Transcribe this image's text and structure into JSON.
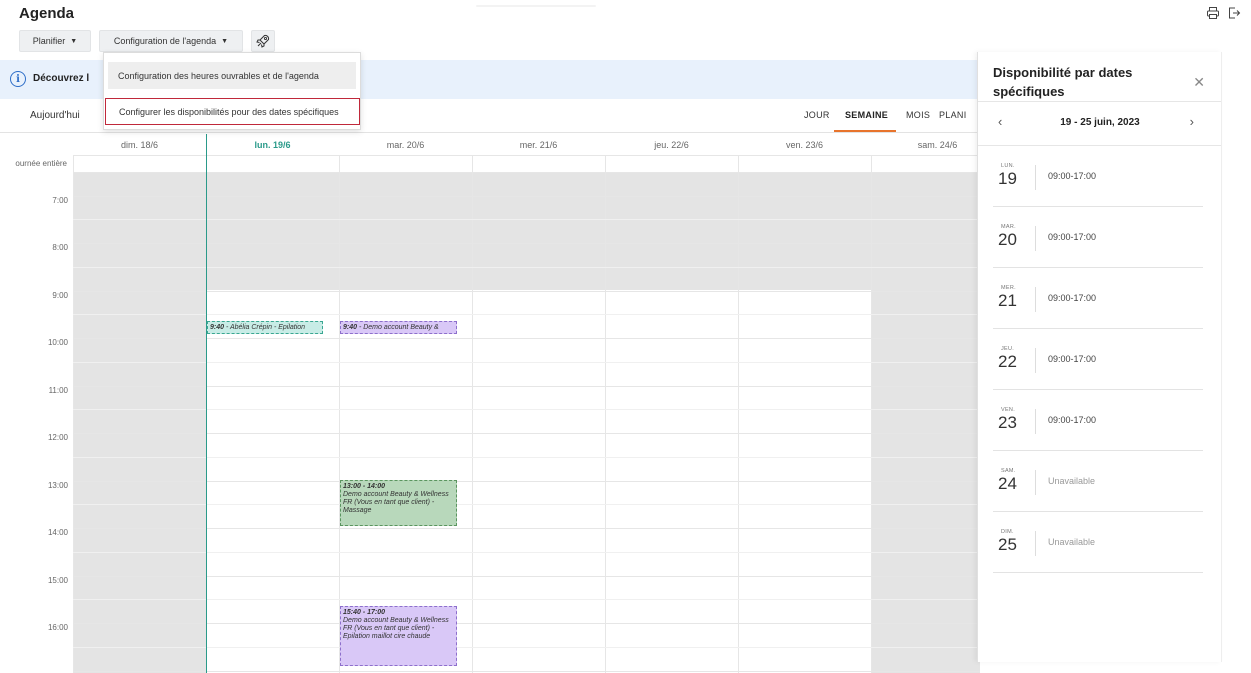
{
  "header": {
    "title": "Agenda",
    "planifier_label": "Planifier",
    "config_label": "Configuration de l'agenda"
  },
  "dropdown": {
    "items": [
      "Configuration des heures ouvrables et de l'agenda",
      "Configurer les disponibilités pour des dates spécifiques"
    ]
  },
  "banner": {
    "text": "Découvrez l"
  },
  "toolbar": {
    "today_label": "Aujourd'hui",
    "views": [
      "JOUR",
      "SEMAINE",
      "MOIS",
      "PLANI"
    ],
    "active_view": "SEMAINE"
  },
  "calendar": {
    "days": [
      "dim. 18/6",
      "lun. 19/6",
      "mar. 20/6",
      "mer. 21/6",
      "jeu. 22/6",
      "ven. 23/6",
      "sam. 24/6"
    ],
    "today_index": 1,
    "allday_label": "ournée entière",
    "hours": [
      "7:00",
      "8:00",
      "9:00",
      "10:00",
      "11:00",
      "12:00",
      "13:00",
      "14:00",
      "15:00",
      "16:00"
    ],
    "events": [
      {
        "day": 1,
        "time": "9:40",
        "title": " - Abélia Crépin - Epilation",
        "color": "teal"
      },
      {
        "day": 2,
        "time": "9:40",
        "title": " - Demo account Beauty &",
        "color": "purple"
      },
      {
        "day": 2,
        "time": "13:00 - 14:00",
        "title": "Demo account Beauty & Wellness FR (Vous en tant que client) - Massage",
        "color": "green"
      },
      {
        "day": 2,
        "time": "15:40 - 17:00",
        "title": "Demo account Beauty & Wellness FR (Vous en tant que client) - Epilation maillot cire chaude",
        "color": "purple"
      }
    ]
  },
  "panel": {
    "title": "Disponibilité par dates spécifiques",
    "range": "19 - 25 juin, 2023",
    "days": [
      {
        "abbr": "LUN.",
        "num": "19",
        "hours": "09:00-17:00"
      },
      {
        "abbr": "MAR.",
        "num": "20",
        "hours": "09:00-17:00"
      },
      {
        "abbr": "MER.",
        "num": "21",
        "hours": "09:00-17:00"
      },
      {
        "abbr": "JEU.",
        "num": "22",
        "hours": "09:00-17:00"
      },
      {
        "abbr": "VEN.",
        "num": "23",
        "hours": "09:00-17:00"
      },
      {
        "abbr": "SAM.",
        "num": "24",
        "hours": "Unavailable"
      },
      {
        "abbr": "DIM.",
        "num": "25",
        "hours": "Unavailable"
      }
    ]
  },
  "colors": {
    "accent": "#e8742c",
    "today": "#2a9a8a",
    "highlight_border": "#c0283a",
    "banner_bg": "#e8f1fc"
  }
}
